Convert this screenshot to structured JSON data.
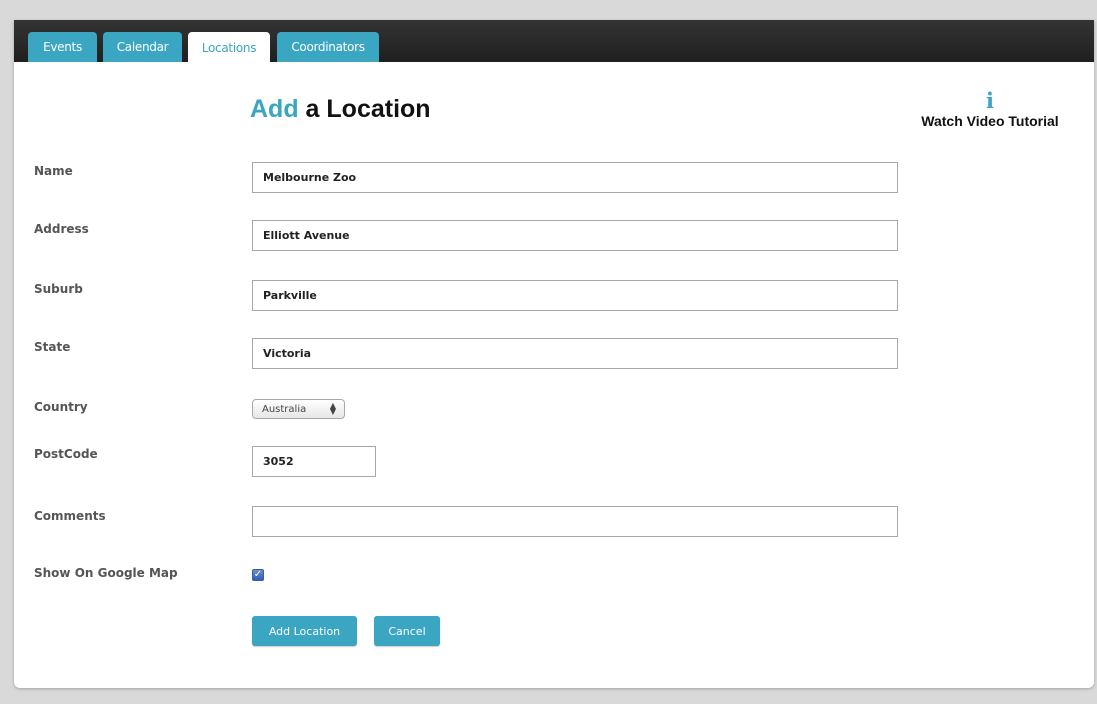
{
  "tabs": [
    {
      "label": "Events",
      "active": false
    },
    {
      "label": "Calendar",
      "active": false
    },
    {
      "label": "Locations",
      "active": true
    },
    {
      "label": "Coordinators",
      "active": false
    }
  ],
  "heading": {
    "accent": "Add",
    "rest": " a Location"
  },
  "tutorial": {
    "icon": "i",
    "label": "Watch Video Tutorial"
  },
  "form": {
    "name": {
      "label": "Name",
      "value": "Melbourne Zoo"
    },
    "address": {
      "label": "Address",
      "value": "Elliott Avenue"
    },
    "suburb": {
      "label": "Suburb",
      "value": "Parkville"
    },
    "state": {
      "label": "State",
      "value": "Victoria"
    },
    "country": {
      "label": "Country",
      "selected": "Australia"
    },
    "postcode": {
      "label": "PostCode",
      "value": "3052"
    },
    "comments": {
      "label": "Comments",
      "value": ""
    },
    "show_map": {
      "label": "Show On Google Map",
      "checked": true
    }
  },
  "buttons": {
    "add": "Add Location",
    "cancel": "Cancel"
  },
  "colors": {
    "accent": "#3aa6c2",
    "tabbar": "#2a2a2a"
  }
}
